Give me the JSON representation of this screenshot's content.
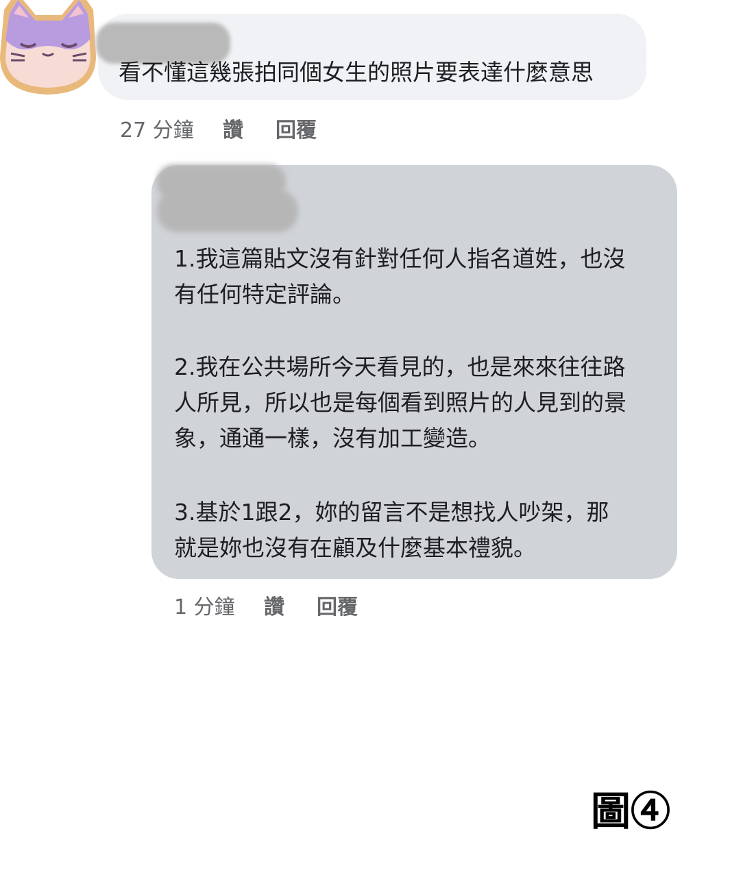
{
  "comment1": {
    "text": "看不懂這幾張拍同個女生的照片要表達什麼意思",
    "time": "27 分鐘",
    "like_label": "讚",
    "reply_label": "回覆"
  },
  "comment2": {
    "paragraph1": "1.我這篇貼文沒有針對任何人指名道姓，也沒\n有任何特定評論。",
    "paragraph2": "2.我在公共場所今天看見的，也是來來往往路\n人所見，所以也是每個看到照片的人見到的景\n象，通通一樣，沒有加工變造。",
    "paragraph3": "3.基於1跟2，妳的留言不是想找人吵架，那\n就是妳也沒有在顧及什麼基本禮貌。",
    "time": "1 分鐘",
    "like_label": "讚",
    "reply_label": "回覆"
  },
  "figure_label": "圖④",
  "colors": {
    "bubble1": "#f0f2f5",
    "bubble2": "#d0d3d8",
    "meta_text": "#65676b",
    "avatar_face": "#f6dcd4",
    "avatar_fur": "#b99be0",
    "avatar_border": "#e9b97c"
  },
  "icons": [
    "cat-avatar-icon"
  ]
}
